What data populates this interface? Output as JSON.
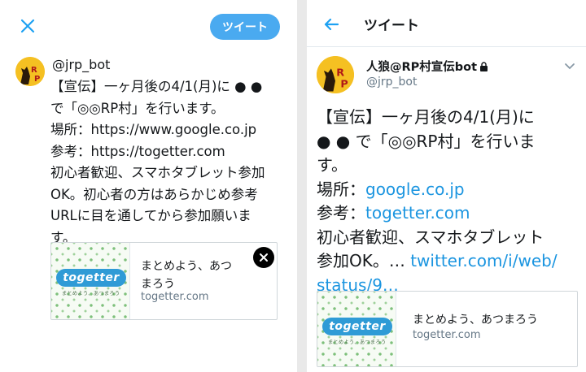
{
  "compose": {
    "tweet_button": "ツイート",
    "handle": "@jrp_bot",
    "body_lines": [
      "【宣伝】一ヶ月後の4/1(月)に ● ●",
      "で「◎◎RP村」を行います。",
      "場所：https://www.google.co.jp",
      "参考：https://togetter.com",
      "初心者歓迎、スマホタブレット参加",
      "OK。初心者の方はあらかじめ参考",
      "URLに目を通してから参加願いま",
      "す。"
    ],
    "card": {
      "title_lines": [
        "まとめよう、あつ",
        "まろう"
      ],
      "domain": "togetter.com",
      "logo_text": "togetter",
      "logo_sub": "まとめよう、あつまろう"
    }
  },
  "detail": {
    "title": "ツイート",
    "name": "人狼@RP村宣伝bot",
    "handle": "@jrp_bot",
    "line1": "【宣伝】一ヶ月後の4/1(月)に",
    "line2": "● ● で「◎◎RP村」を行いま",
    "line3": "す。",
    "place_label": "場所：",
    "place_link": "google.co.jp",
    "ref_label": "参考：",
    "ref_link": "togetter.com",
    "line6": "初心者歓迎、スマホタブレット",
    "line7_text": "参加OK。… ",
    "line7_link": "twitter.com/i/web/",
    "line8_link": "status/9…",
    "card": {
      "title": "まとめよう、あつまろう",
      "domain": "togetter.com",
      "logo_text": "togetter",
      "logo_sub": "まとめよう、あつまろう"
    }
  },
  "colors": {
    "accent": "#1da1f2",
    "link": "#1b95e0",
    "avatar_bg": "#f5c022"
  },
  "icons": [
    "close-icon",
    "back-arrow-icon",
    "lock-icon",
    "chevron-down-icon",
    "close-circle-icon"
  ]
}
